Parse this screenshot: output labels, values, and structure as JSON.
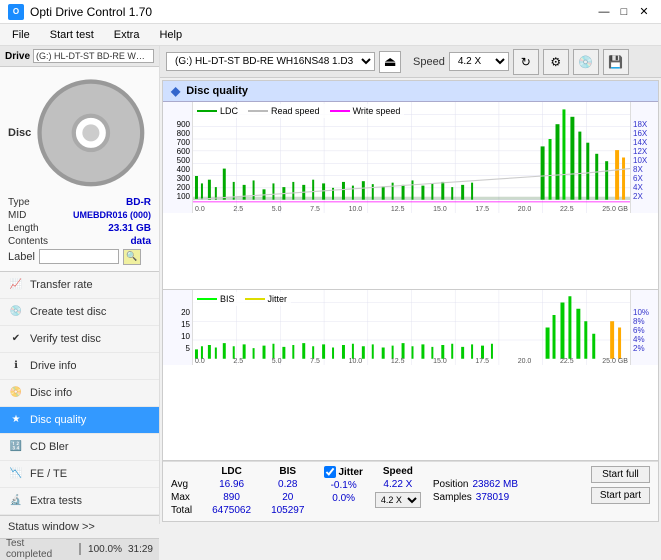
{
  "app": {
    "title": "Opti Drive Control 1.70",
    "icon": "O"
  },
  "titlebar": {
    "minimize": "—",
    "maximize": "□",
    "close": "✕"
  },
  "menubar": {
    "items": [
      "File",
      "Start test",
      "Extra",
      "Help"
    ]
  },
  "drive_bar": {
    "label": "Drive",
    "drive_value": "(G:)  HL-DT-ST BD-RE  WH16NS48 1.D3",
    "speed_label": "Speed",
    "speed_value": "4.2 X"
  },
  "disc": {
    "type_label": "Type",
    "type_value": "BD-R",
    "mid_label": "MID",
    "mid_value": "UMEBDR016 (000)",
    "length_label": "Length",
    "length_value": "23.31 GB",
    "contents_label": "Contents",
    "contents_value": "data",
    "label_label": "Label",
    "label_value": ""
  },
  "nav": {
    "items": [
      {
        "id": "transfer-rate",
        "label": "Transfer rate",
        "icon": "📈"
      },
      {
        "id": "create-test-disc",
        "label": "Create test disc",
        "icon": "💿"
      },
      {
        "id": "verify-test-disc",
        "label": "Verify test disc",
        "icon": "✔"
      },
      {
        "id": "drive-info",
        "label": "Drive info",
        "icon": "ℹ"
      },
      {
        "id": "disc-info",
        "label": "Disc info",
        "icon": "📀"
      },
      {
        "id": "disc-quality",
        "label": "Disc quality",
        "icon": "★",
        "active": true
      },
      {
        "id": "cd-bler",
        "label": "CD Bler",
        "icon": "🔢"
      },
      {
        "id": "fe-te",
        "label": "FE / TE",
        "icon": "📉"
      },
      {
        "id": "extra-tests",
        "label": "Extra tests",
        "icon": "🔬"
      }
    ]
  },
  "status_window": {
    "label": "Status window >>"
  },
  "progress": {
    "bar_width": "100",
    "percent": "100.0%",
    "time": "31:29",
    "status": "Test completed"
  },
  "chart": {
    "title": "Disc quality",
    "legend_top": [
      {
        "label": "LDC",
        "color": "#00aa00"
      },
      {
        "label": "Read speed",
        "color": "#aaaaaa"
      },
      {
        "label": "Write speed",
        "color": "#ff00ff"
      }
    ],
    "legend_bottom": [
      {
        "label": "BIS",
        "color": "#00ff00"
      },
      {
        "label": "Jitter",
        "color": "#ffff00"
      }
    ],
    "top_yaxis": [
      "900",
      "800",
      "700",
      "600",
      "500",
      "400",
      "300",
      "200",
      "100"
    ],
    "top_yaxis_right": [
      "18X",
      "16X",
      "14X",
      "12X",
      "10X",
      "8X",
      "6X",
      "4X",
      "2X"
    ],
    "bottom_yaxis": [
      "20",
      "15",
      "10",
      "5"
    ],
    "bottom_yaxis_right": [
      "10%",
      "8%",
      "6%",
      "4%",
      "2%"
    ],
    "xaxis": [
      "0.0",
      "2.5",
      "5.0",
      "7.5",
      "10.0",
      "12.5",
      "15.0",
      "17.5",
      "20.0",
      "22.5",
      "25.0 GB"
    ]
  },
  "stats": {
    "headers": [
      "LDC",
      "BIS",
      "",
      "Jitter",
      "Speed",
      ""
    ],
    "avg_label": "Avg",
    "avg_ldc": "16.96",
    "avg_bis": "0.28",
    "avg_jitter": "-0.1%",
    "max_label": "Max",
    "max_ldc": "890",
    "max_bis": "20",
    "max_jitter": "0.0%",
    "total_label": "Total",
    "total_ldc": "6475062",
    "total_bis": "105297",
    "position_label": "Position",
    "position_value": "23862 MB",
    "samples_label": "Samples",
    "samples_value": "378019",
    "speed_avg": "4.22 X",
    "speed_select": "4.2 X",
    "start_full": "Start full",
    "start_part": "Start part",
    "jitter_checked": true
  }
}
